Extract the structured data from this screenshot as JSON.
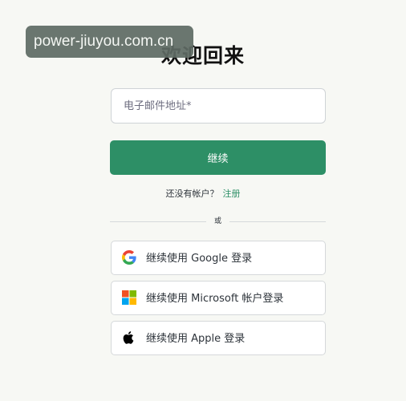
{
  "watermark": "power-jiuyou.com.cn",
  "title": "欢迎回来",
  "email": {
    "placeholder": "电子邮件地址*",
    "value": ""
  },
  "continue_label": "继续",
  "signup": {
    "prompt": "还没有帐户？",
    "link_label": "注册"
  },
  "divider_text": "或",
  "social": {
    "google": {
      "label": "继续使用 Google 登录",
      "icon": "google-icon"
    },
    "microsoft": {
      "label": "继续使用 Microsoft 帐户登录",
      "icon": "microsoft-icon"
    },
    "apple": {
      "label": "继续使用 Apple 登录",
      "icon": "apple-icon"
    }
  },
  "colors": {
    "accent": "#2d8f66",
    "background": "#f7f8f4",
    "watermark_bg": "#5f6b64"
  }
}
